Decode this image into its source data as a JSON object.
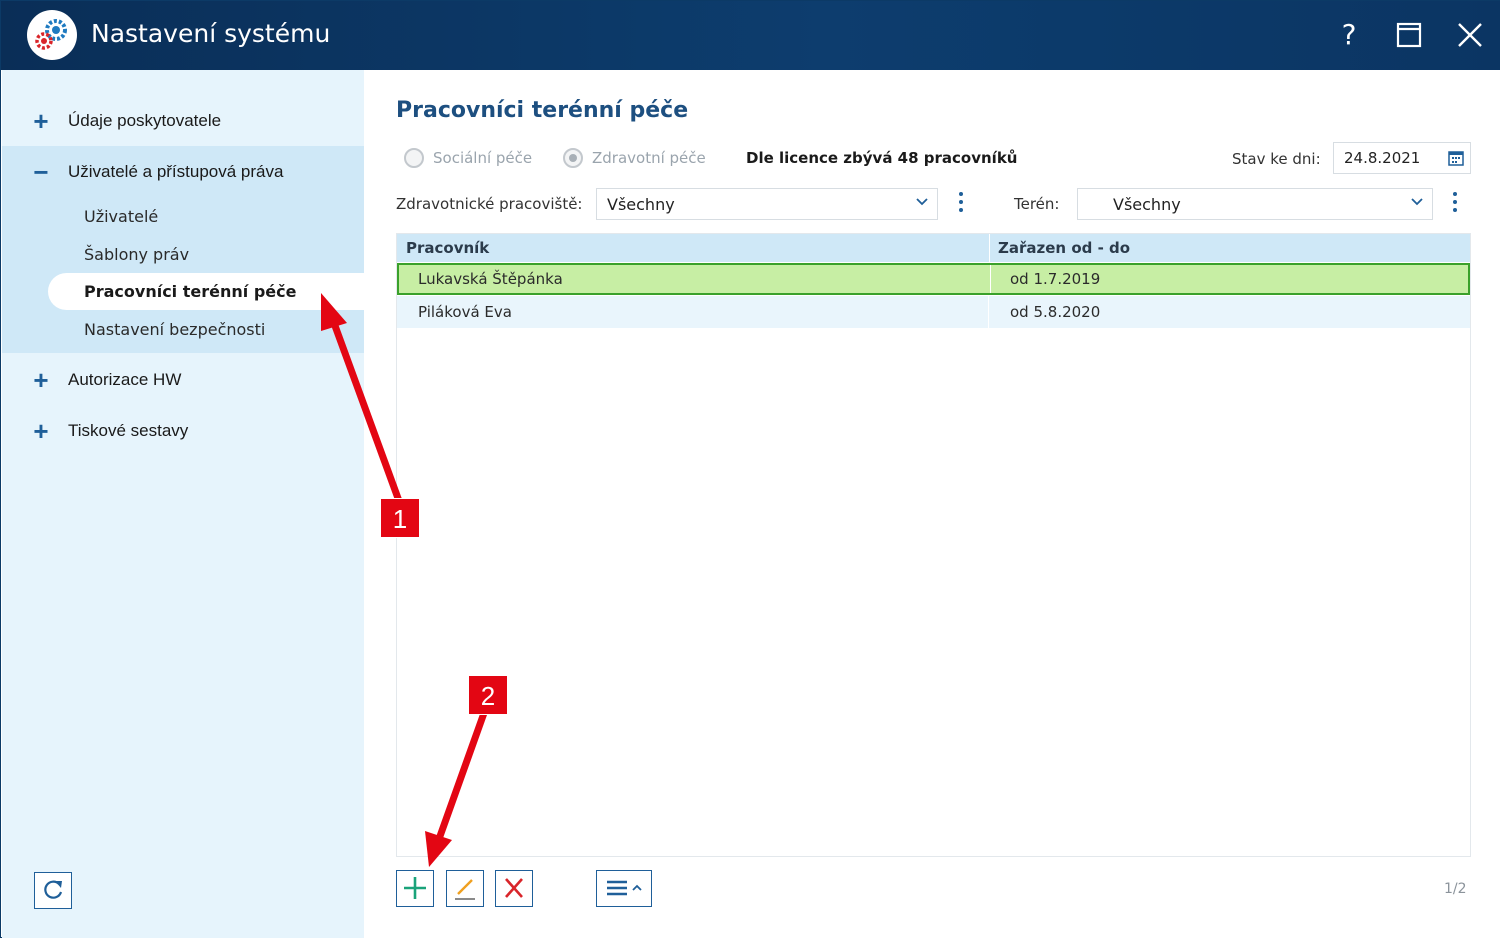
{
  "window": {
    "title": "Nastavení systému",
    "help_label": "?",
    "maximize_label": "☐",
    "close_label": "✕"
  },
  "sidebar": {
    "items": [
      {
        "sign": "+",
        "label": "Údaje poskytovatele"
      },
      {
        "sign": "−",
        "label": "Uživatelé a přístupová práva"
      },
      {
        "sign": "+",
        "label": "Autorizace HW"
      },
      {
        "sign": "+",
        "label": "Tiskové sestavy"
      }
    ],
    "subitems": [
      {
        "label": "Uživatelé"
      },
      {
        "label": "Šablony práv"
      },
      {
        "label": "Pracovníci terénní péče",
        "active": true
      },
      {
        "label": "Nastavení bezpečnosti"
      }
    ]
  },
  "main": {
    "title": "Pracovníci terénní péče",
    "radios": [
      {
        "label": "Sociální péče",
        "checked": false
      },
      {
        "label": "Zdravotní péče",
        "checked": true
      }
    ],
    "license_text": "Dle licence zbývá 48 pracovníků",
    "date_label": "Stav ke dni:",
    "date_value": "24.8.2021",
    "filters": {
      "workplace_label": "Zdravotnické pracoviště:",
      "workplace_value": "Všechny",
      "terrain_label": "Terén:",
      "terrain_value": "Všechny"
    },
    "grid": {
      "columns": [
        "Pracovník",
        "Zařazen od - do"
      ],
      "rows": [
        {
          "name": "Lukavská Štěpánka",
          "period": "od 1.7.2019",
          "selected": true
        },
        {
          "name": "Piláková Eva",
          "period": "od 5.8.2020",
          "selected": false
        }
      ]
    },
    "pager": "1/2"
  },
  "annotations": {
    "badge_1": "1",
    "badge_2": "2",
    "color": "#e30613"
  },
  "colors": {
    "titlebar": "#0d3d6e",
    "sidebar": "#e6f4fc",
    "accent": "#1f5f99",
    "selected_row": "#c7eea4"
  }
}
